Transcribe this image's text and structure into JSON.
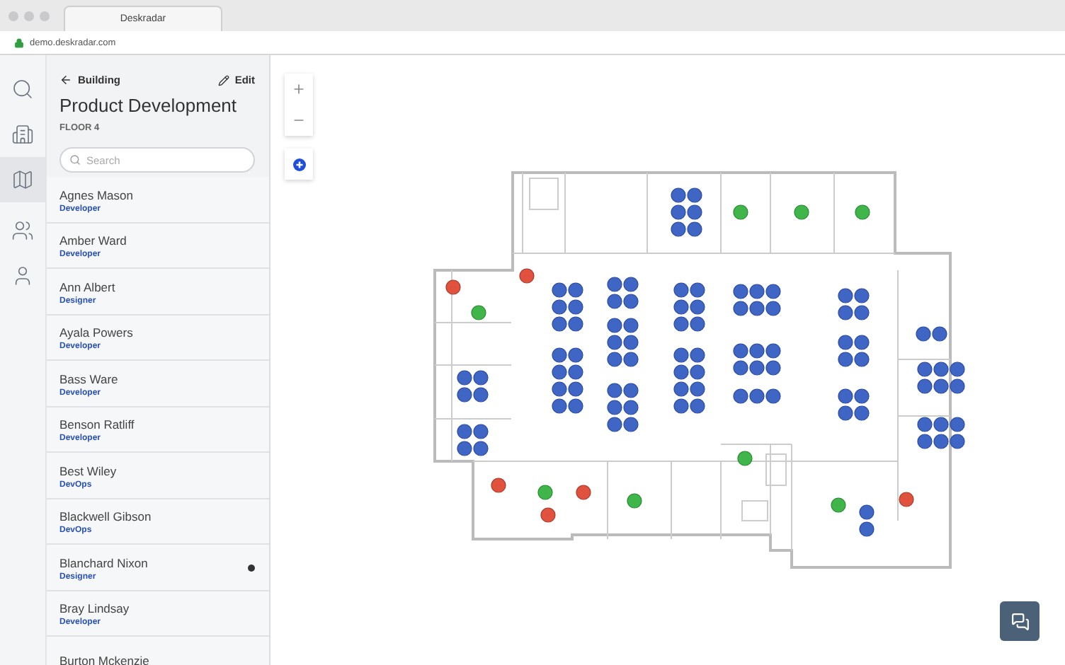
{
  "browser": {
    "tab_title": "Deskradar",
    "url": "demo.deskradar.com"
  },
  "rail": [
    {
      "kind": "search",
      "selected": false
    },
    {
      "kind": "building",
      "selected": false
    },
    {
      "kind": "floorplan",
      "selected": true
    },
    {
      "kind": "team",
      "selected": false
    },
    {
      "kind": "person",
      "selected": false
    }
  ],
  "panel": {
    "back_label": "Building",
    "edit_label": "Edit",
    "title": "Product Development",
    "subtitle": "FLOOR 4",
    "search": {
      "placeholder": "Search"
    },
    "people": [
      {
        "name": "Agnes Mason",
        "role": "Developer",
        "marked": false
      },
      {
        "name": "Amber Ward",
        "role": "Developer",
        "marked": false
      },
      {
        "name": "Ann Albert",
        "role": "Designer",
        "marked": false
      },
      {
        "name": "Ayala Powers",
        "role": "Developer",
        "marked": false
      },
      {
        "name": "Bass Ware",
        "role": "Developer",
        "marked": false
      },
      {
        "name": "Benson Ratliff",
        "role": "Developer",
        "marked": false
      },
      {
        "name": "Best Wiley",
        "role": "DevOps",
        "marked": false
      },
      {
        "name": "Blackwell Gibson",
        "role": "DevOps",
        "marked": false
      },
      {
        "name": "Blanchard Nixon",
        "role": "Designer",
        "marked": true
      },
      {
        "name": "Bray Lindsay",
        "role": "Developer",
        "marked": false
      },
      {
        "name": "Burton Mckenzie",
        "marked": false
      }
    ]
  }
}
